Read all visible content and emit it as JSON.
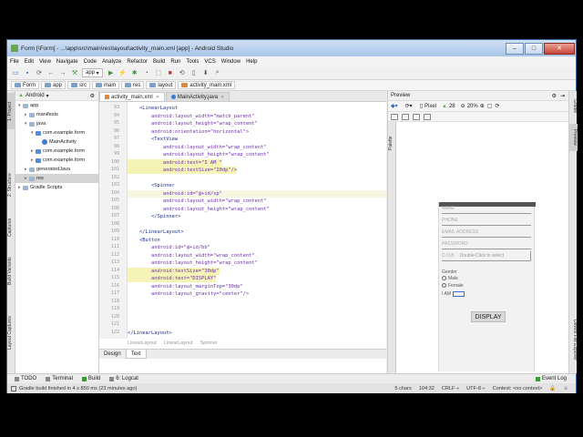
{
  "window": {
    "title": "Form [\\Form] - ...\\app\\src\\main\\res\\layout\\activity_main.xml [app] - Android Studio"
  },
  "menu": [
    "File",
    "Edit",
    "View",
    "Navigate",
    "Code",
    "Analyze",
    "Refactor",
    "Build",
    "Run",
    "Tools",
    "VCS",
    "Window",
    "Help"
  ],
  "toolbar": {
    "run_config": "app"
  },
  "breadcrumbs": [
    "Form",
    "app",
    "src",
    "main",
    "res",
    "layout",
    "activity_main.xml"
  ],
  "project": {
    "header": "Android",
    "tree": [
      {
        "label": "app",
        "indent": 0
      },
      {
        "label": "manifests",
        "indent": 1
      },
      {
        "label": "java",
        "indent": 1
      },
      {
        "label": "com.example.form",
        "indent": 2
      },
      {
        "label": "MainActivity",
        "indent": 3
      },
      {
        "label": "com.example.form",
        "indent": 2
      },
      {
        "label": "com.example.form",
        "indent": 2
      },
      {
        "label": "generatedJava",
        "indent": 1
      },
      {
        "label": "res",
        "indent": 1
      },
      {
        "label": "Gradle Scripts",
        "indent": 0
      }
    ]
  },
  "left_tabs": [
    "1: Project",
    "2: Structure",
    "Captures",
    "Build Variants",
    "Layout Captures"
  ],
  "editor": {
    "tabs": [
      "activity_main.xml",
      "MainActivity.java"
    ],
    "line_numbers": [
      "93",
      "94",
      "95",
      "96",
      "97",
      "98",
      "99",
      "100",
      "101",
      "102",
      "103",
      "104",
      "105",
      "106",
      "107",
      "108",
      "109",
      "110",
      "111",
      "112",
      "113",
      "114",
      "115",
      "116",
      "117",
      "118",
      "119",
      "120",
      "121",
      "122"
    ],
    "lines": [
      {
        "text": "    <LinearLayout",
        "style": "tag"
      },
      {
        "text": "        android:layout_width=\"match_parent\"",
        "style": "attr"
      },
      {
        "text": "        android:layout_height=\"wrap_content\"",
        "style": "attr"
      },
      {
        "text": "        android:orientation=\"horizontal\">",
        "style": "attr"
      },
      {
        "text": "        <TextView",
        "style": "tag"
      },
      {
        "text": "            android:layout_width=\"wrap_content\"",
        "style": "attr"
      },
      {
        "text": "            android:layout_height=\"wrap_content\"",
        "style": "attr"
      },
      {
        "text": "            android:text=\"I AM \"",
        "style": "hl"
      },
      {
        "text": "            android:textSize=\"20dp\"/>",
        "style": "hl"
      },
      {
        "text": "",
        "style": "plain"
      },
      {
        "text": "        <Spinner",
        "style": "tag"
      },
      {
        "text": "            android:id=\"@+id/sp\"",
        "style": "cursor"
      },
      {
        "text": "            android:layout_width=\"wrap_content\"",
        "style": "attr"
      },
      {
        "text": "            android:layout_height=\"wrap_content\"",
        "style": "attr"
      },
      {
        "text": "        </Spinner>",
        "style": "tag"
      },
      {
        "text": "",
        "style": "plain"
      },
      {
        "text": "    </LinearLayout>",
        "style": "tag"
      },
      {
        "text": "    <Button",
        "style": "tag"
      },
      {
        "text": "        android:id=\"@+id/bb\"",
        "style": "attr"
      },
      {
        "text": "        android:layout_width=\"wrap_content\"",
        "style": "attr"
      },
      {
        "text": "        android:layout_height=\"wrap_content\"",
        "style": "attr"
      },
      {
        "text": "        android:textSize=\"30dp\"",
        "style": "hl"
      },
      {
        "text": "        android:text=\"DISPLAY\"",
        "style": "hl"
      },
      {
        "text": "        android:layout_marginTop=\"30dp\"",
        "style": "attr"
      },
      {
        "text": "        android:layout_gravity=\"center\"/>",
        "style": "attr"
      },
      {
        "text": "",
        "style": "plain"
      },
      {
        "text": "",
        "style": "plain"
      },
      {
        "text": "",
        "style": "plain"
      },
      {
        "text": "",
        "style": "plain"
      },
      {
        "text": "</LinearLayout>",
        "style": "tag"
      }
    ],
    "structure_crumbs": [
      "LinearLayout",
      "LinearLayout",
      "Spinner"
    ],
    "bottom_tabs": [
      "Design",
      "Text"
    ]
  },
  "preview": {
    "header": "Preview",
    "device": "Pixel",
    "api": "28",
    "zoom": "20%",
    "form": {
      "fields": [
        "NAME",
        "PHONE",
        "EMAIL ADDRESS",
        "PASSWORD"
      ],
      "dob_label": "D.O.B",
      "dob_hint": "Double-Click to select",
      "gender_label": "Gender",
      "radios": [
        "Male",
        "Female"
      ],
      "spinner_label": "I AM",
      "button": "DISPLAY"
    }
  },
  "right_tabs": [
    "Gradle",
    "Preview",
    "Device File Explorer"
  ],
  "bottom_tabs": [
    "TODO",
    "Terminal",
    "Build",
    "6: Logcat",
    "Event Log"
  ],
  "status": {
    "message": "Gradle build finished in 4 s 850 ms (23 minutes ago)",
    "chars": "5 chars",
    "position": "104:32",
    "line_sep": "CRLF ÷",
    "encoding": "UTF-8 ÷",
    "context": "Context: <no context>"
  }
}
